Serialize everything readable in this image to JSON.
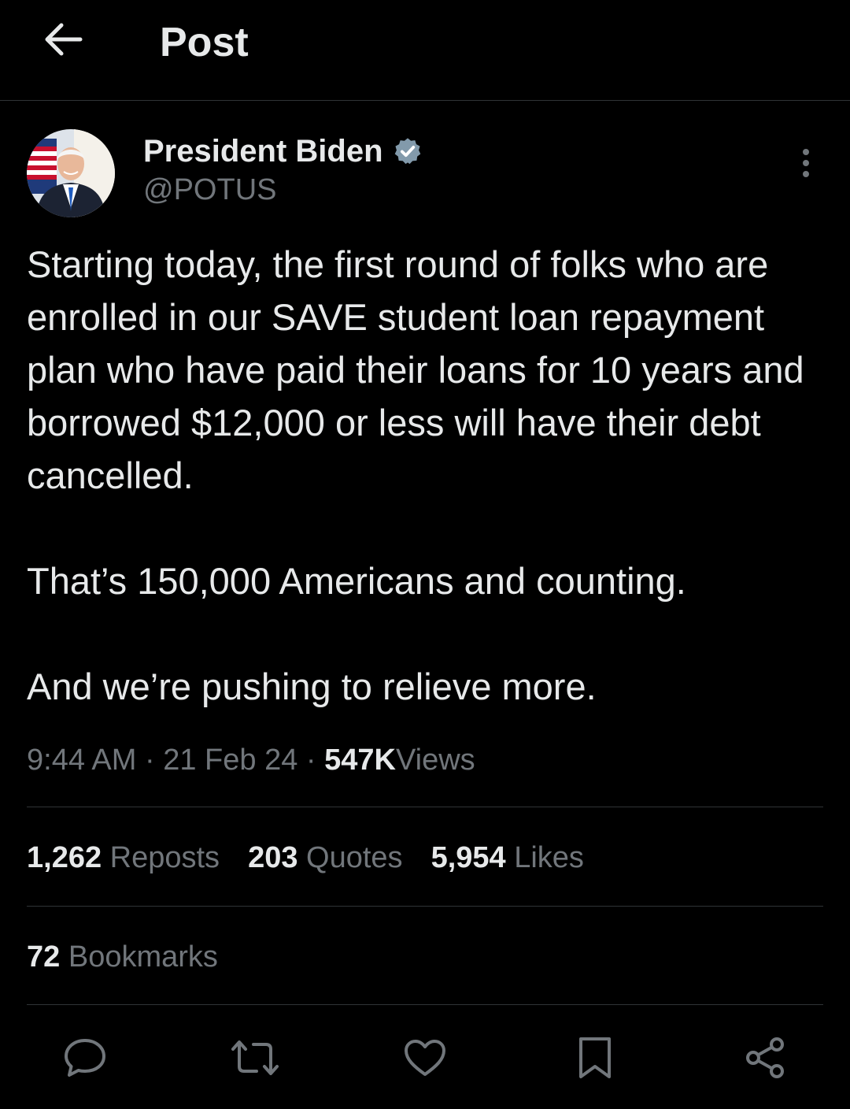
{
  "header": {
    "title": "Post",
    "back_icon": "arrow-left-icon"
  },
  "author": {
    "name": "President Biden",
    "handle": "@POTUS",
    "verified": true,
    "avatar_icon": "avatar-photo"
  },
  "post": {
    "paragraphs": [
      "Starting today, the first round of folks who are enrolled in our SAVE student loan repayment plan who have paid their loans for 10 years and borrowed $12,000 or less will have their debt cancelled.",
      "That’s 150,000 Americans and counting.",
      "And we’re pushing to relieve more."
    ],
    "time": "9:44 AM",
    "date": "21 Feb 24",
    "separator": "·",
    "views_count": "547K",
    "views_label": "Views"
  },
  "stats": {
    "reposts_count": "1,262",
    "reposts_label": "Reposts",
    "quotes_count": "203",
    "quotes_label": "Quotes",
    "likes_count": "5,954",
    "likes_label": "Likes",
    "bookmarks_count": "72",
    "bookmarks_label": "Bookmarks"
  },
  "actions": [
    {
      "icon": "reply-icon"
    },
    {
      "icon": "repost-icon"
    },
    {
      "icon": "like-icon"
    },
    {
      "icon": "bookmark-icon"
    },
    {
      "icon": "share-icon"
    }
  ],
  "colors": {
    "background": "#000000",
    "text": "#e7e9ea",
    "secondary_text": "#71767b",
    "divider": "#2f3336",
    "verified_badge": "#829aab"
  }
}
